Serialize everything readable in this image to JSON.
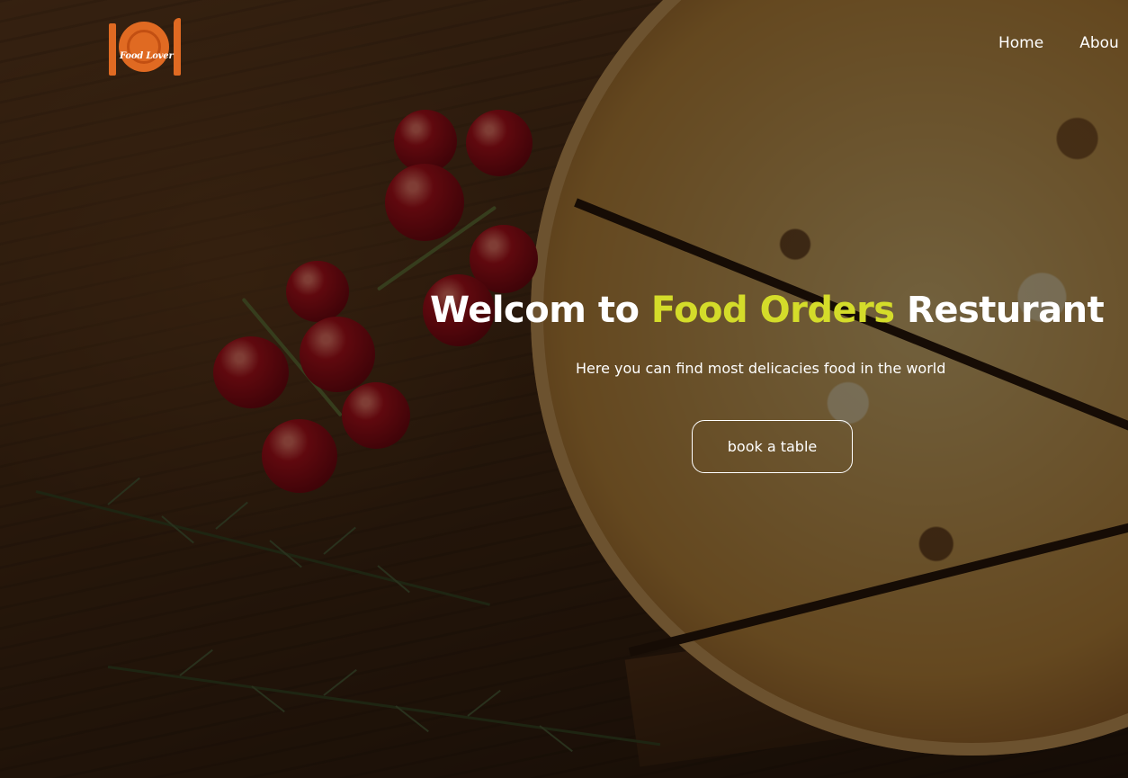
{
  "brand": {
    "logo_text": "Food Lover"
  },
  "nav": {
    "items": [
      {
        "label": "Home"
      },
      {
        "label": "Abou"
      }
    ]
  },
  "hero": {
    "title_prefix": "Welcom to ",
    "title_accent": "Food Orders",
    "title_suffix": " Resturant",
    "subtitle": "Here you can find most delicacies food in the world",
    "cta_label": "book a table"
  },
  "colors": {
    "accent": "#d4dc2a",
    "logo": "#e06a22",
    "overlay": "rgba(0,0,0,0.5)"
  },
  "icons": {
    "logo": "fork-plate-knife-icon"
  }
}
